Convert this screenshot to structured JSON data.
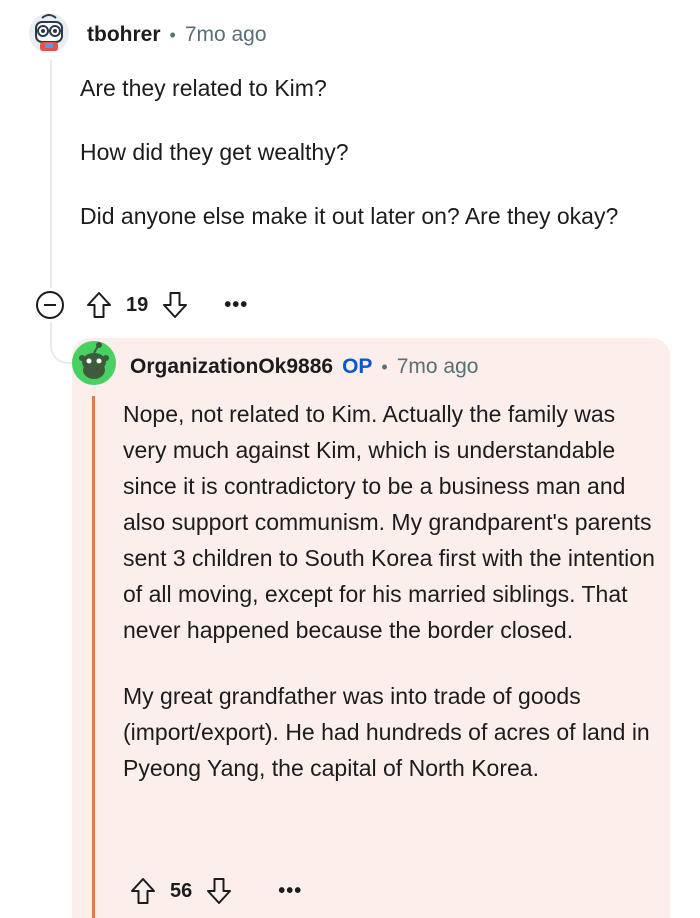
{
  "parent_comment": {
    "username": "tbohrer",
    "separator": "•",
    "time": "7mo ago",
    "paragraphs": [
      "Are they related to Kim?",
      "How did they get wealthy?",
      "Did anyone else make it out later on? Are they okay?"
    ],
    "vote_count": "19",
    "more_label": "•••"
  },
  "reply_comment": {
    "username": "OrganizationOk9886",
    "op_badge": "OP",
    "separator": "•",
    "time": "7mo ago",
    "paragraphs": [
      "Nope, not related to Kim. Actually the family was very much against Kim, which is understandable since it is contradictory to be a business man and also support communism. My grandparent's parents sent 3 children to South Korea first with the intention of all moving, except for his married siblings. That never happened because the border closed.",
      "My great grandfather was into trade of goods (import/export). He had hundreds of acres of land in Pyeong Yang, the capital of North Korea."
    ],
    "vote_count": "56",
    "more_label": "•••"
  },
  "icons": {
    "upvote": "upvote-icon",
    "downvote": "downvote-icon",
    "collapse": "collapse-icon",
    "more": "more-options-icon"
  },
  "colors": {
    "op_badge": "#0a56d1",
    "reply_background": "#fbeeeb",
    "reply_thread_line": "#e07a52",
    "thread_line": "#e5ebee",
    "meta_text": "#576f76",
    "op_avatar": "#46d160"
  }
}
